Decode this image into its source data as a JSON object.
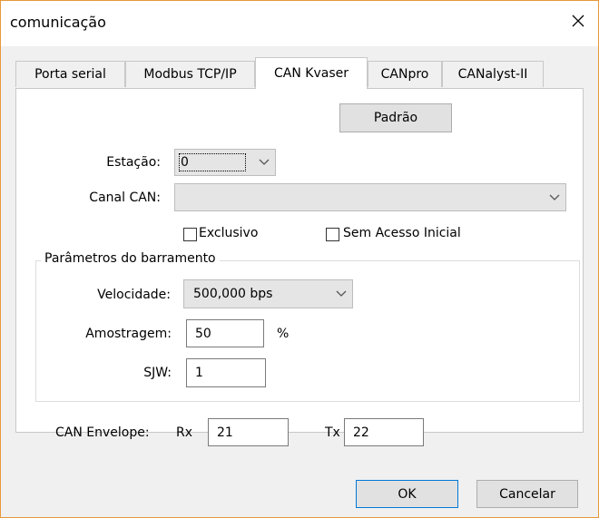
{
  "window": {
    "title": "comunicação"
  },
  "tabs": [
    {
      "label": "Porta serial"
    },
    {
      "label": "Modbus TCP/IP"
    },
    {
      "label": "CAN Kvaser"
    },
    {
      "label": "CANpro"
    },
    {
      "label": "CANalyst-II"
    }
  ],
  "active_tab": "CAN Kvaser",
  "panel": {
    "default_button": "Padrão",
    "station_label": "Estação:",
    "station_value": "0",
    "can_channel_label": "Canal CAN:",
    "can_channel_value": "",
    "exclusive_label": "Exclusivo",
    "exclusive_checked": false,
    "no_initial_access_label": "Sem Acesso Inicial",
    "no_initial_access_checked": false,
    "bus_group_title": "Parâmetros do barramento",
    "speed_label": "Velocidade:",
    "speed_value": "500,000 bps",
    "sampling_label": "Amostragem:",
    "sampling_value": "50",
    "sampling_unit": "%",
    "sjw_label": "SJW:",
    "sjw_value": "1",
    "envelope_label": "CAN Envelope:",
    "rx_label": "Rx",
    "rx_value": "21",
    "tx_label": "Tx",
    "tx_value": "22"
  },
  "footer": {
    "ok_label": "OK",
    "cancel_label": "Cancelar"
  },
  "icons": {
    "close": "close-icon",
    "dropdown": "chevron-down-icon"
  },
  "colors": {
    "window_border": "#e8973a",
    "focus_border": "#0078d7"
  }
}
